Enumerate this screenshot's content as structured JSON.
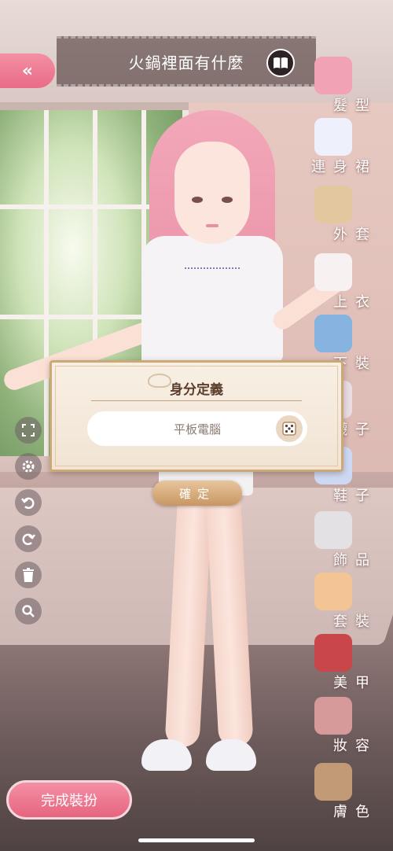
{
  "header": {
    "title": "火鍋裡面有什麼",
    "back_icon": "«"
  },
  "categories": [
    {
      "label": "髮型",
      "icon": "hairstyle-icon",
      "color": "#f1a3b3"
    },
    {
      "label": "連身裙",
      "icon": "dress-icon",
      "color": "#eef0fb"
    },
    {
      "label": "外套",
      "icon": "jacket-icon",
      "color": "#e2c79f"
    },
    {
      "label": "上衣",
      "icon": "top-icon",
      "color": "#f7f1f2"
    },
    {
      "label": "下裝",
      "icon": "bottoms-icon",
      "color": "#86b3df"
    },
    {
      "label": "襪子",
      "icon": "socks-icon",
      "color": "#e9dde3"
    },
    {
      "label": "鞋子",
      "icon": "shoes-icon",
      "color": "#cfd8f2"
    },
    {
      "label": "飾品",
      "icon": "accessory-icon",
      "color": "#e4e1e4"
    },
    {
      "label": "套裝",
      "icon": "outfit-icon",
      "color": "#f3c594"
    },
    {
      "label": "美甲",
      "icon": "nail-polish-icon",
      "color": "#c9474b"
    },
    {
      "label": "妝容",
      "icon": "makeup-icon",
      "color": "#d79a9b"
    },
    {
      "label": "膚色",
      "icon": "skin-color-icon",
      "color": "#c39a76"
    }
  ],
  "dialog": {
    "title": "身分定義",
    "identity_value": "平板電腦",
    "confirm_label": "確定"
  },
  "footer": {
    "finish_label": "完成裝扮"
  },
  "colors": {
    "accent_pink": "#e96b88",
    "dialog_gold": "#cda877"
  }
}
